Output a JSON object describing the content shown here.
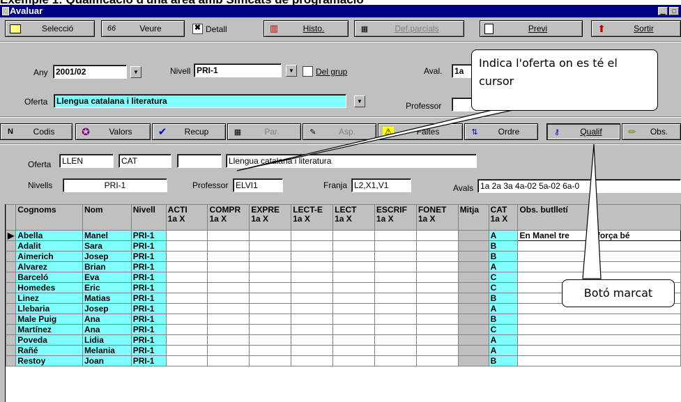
{
  "heading": "Exemple 1: Qualificació d'una àrea amb Simcats de programació",
  "window": {
    "title": "Avaluar",
    "min_glyph": "▁",
    "max_glyph": "□"
  },
  "toolbar1": [
    {
      "name": "seleccio-button",
      "icon": "folder-icon",
      "glyph": "🗀",
      "label": "Selecció",
      "disabled": false
    },
    {
      "name": "veure-button",
      "icon": "glasses-icon",
      "glyph": "66",
      "label": "Veure",
      "disabled": false
    },
    {
      "name": "histo-button",
      "icon": "chart-icon",
      "glyph": "▥",
      "label": "Histo.",
      "disabled": false
    },
    {
      "name": "def-parcials-button",
      "icon": "calendar-icon",
      "glyph": "▦",
      "label": "Def.parcials",
      "disabled": true
    },
    {
      "name": "previ-button",
      "icon": "preview-icon",
      "glyph": "🔍",
      "label": "Previ",
      "disabled": false
    },
    {
      "name": "sortir-button",
      "icon": "exit-icon",
      "glyph": "⬆",
      "label": "Sortir",
      "disabled": false
    }
  ],
  "detall": {
    "label": "Detall",
    "checked": "✖"
  },
  "form": {
    "any_label": "Any",
    "any_value": "2001/02",
    "nivell_label": "Nivell",
    "nivell_value": "PRI-1",
    "del_grup_label": "Del grup",
    "aval_label": "Aval.",
    "aval_value": "1a",
    "oferta_label": "Oferta",
    "oferta_value": "Llengua catalana i literatura",
    "professor_label": "Professor",
    "professor_value": ""
  },
  "toolbar2": [
    {
      "name": "codis-button",
      "icon": "codes-icon",
      "glyph": "N",
      "label": "Codis",
      "disabled": false,
      "pressed": false
    },
    {
      "name": "valors-button",
      "icon": "values-icon",
      "glyph": "✪",
      "label": "Valors",
      "disabled": false,
      "pressed": false
    },
    {
      "name": "recup-button",
      "icon": "check-icon",
      "glyph": "✔",
      "label": "Recup",
      "disabled": false,
      "pressed": false
    },
    {
      "name": "par-button",
      "icon": "calendar-icon",
      "glyph": "▦",
      "label": "Par.",
      "disabled": true,
      "pressed": false
    },
    {
      "name": "asp-button",
      "icon": "aspects-icon",
      "glyph": "✎",
      "label": "Asp.",
      "disabled": true,
      "pressed": false
    },
    {
      "name": "faltes-button",
      "icon": "warning-icon",
      "glyph": "⚠",
      "label": "Faltes",
      "disabled": false,
      "pressed": false
    },
    {
      "name": "ordre-button",
      "icon": "order-icon",
      "glyph": "⇅",
      "label": "Ordre",
      "disabled": false,
      "pressed": false
    },
    {
      "name": "qualif-button",
      "icon": "key-icon",
      "glyph": "⚷",
      "label": "Qualif",
      "disabled": false,
      "pressed": true
    },
    {
      "name": "obs-button",
      "icon": "pencil-icon",
      "glyph": "✏",
      "label": "Obs.",
      "disabled": false,
      "pressed": false
    }
  ],
  "info": {
    "oferta_label": "Oferta",
    "oferta_code1": "LLEN",
    "oferta_code2": "CAT",
    "oferta_code3": "",
    "oferta_desc": "Llengua catalana i literatura",
    "nivells_label": "Nivells",
    "nivells_value": "PRI-1",
    "professor_label": "Professor",
    "professor_value": "ELVI1",
    "franja_label": "Franja",
    "franja_value": "L2,X1,V1",
    "avals_label": "Avals",
    "avals_value": "1a 2a 3a 4a-02 5a-02 6a-0"
  },
  "table": {
    "headers": [
      {
        "l1": "Cognoms",
        "l2": ""
      },
      {
        "l1": "Nom",
        "l2": ""
      },
      {
        "l1": "Nivell",
        "l2": ""
      },
      {
        "l1": "ACTI",
        "l2": "1a X"
      },
      {
        "l1": "COMPR",
        "l2": "1a X"
      },
      {
        "l1": "EXPRE",
        "l2": "1a X"
      },
      {
        "l1": "LECT-E",
        "l2": "1a X"
      },
      {
        "l1": "LECT",
        "l2": "1a X"
      },
      {
        "l1": "ESCRIF",
        "l2": "1a X"
      },
      {
        "l1": "FONET",
        "l2": "1a X"
      },
      {
        "l1": "Mitja",
        "l2": ""
      },
      {
        "l1": "CAT",
        "l2": "1a X"
      },
      {
        "l1": "Obs. butlletí",
        "l2": ""
      }
    ],
    "rows": [
      {
        "cognoms": "Abella",
        "nom": "Manel",
        "nivell": "PRI-1",
        "cat": "A",
        "obs": "En Manel tre",
        "obs2": "força bé"
      },
      {
        "cognoms": "Adalit",
        "nom": "Sara",
        "nivell": "PRI-1",
        "cat": "B",
        "obs": "",
        "obs2": ""
      },
      {
        "cognoms": "Aimerich",
        "nom": "Josep",
        "nivell": "PRI-1",
        "cat": "B",
        "obs": "",
        "obs2": ""
      },
      {
        "cognoms": "Alvarez",
        "nom": "Brian",
        "nivell": "PRI-1",
        "cat": "A",
        "obs": "",
        "obs2": ""
      },
      {
        "cognoms": "Barceló",
        "nom": "Eva",
        "nivell": "PRI-1",
        "cat": "C",
        "obs": "",
        "obs2": ""
      },
      {
        "cognoms": "Homedes",
        "nom": "Eric",
        "nivell": "PRI-1",
        "cat": "C",
        "obs": "",
        "obs2": ""
      },
      {
        "cognoms": "Linez",
        "nom": "Matias",
        "nivell": "PRI-1",
        "cat": "B",
        "obs": "",
        "obs2": ""
      },
      {
        "cognoms": "Llebaria",
        "nom": "Josep",
        "nivell": "PRI-1",
        "cat": "A",
        "obs": "",
        "obs2": ""
      },
      {
        "cognoms": "Male Puig",
        "nom": "Ana",
        "nivell": "PRI-1",
        "cat": "B",
        "obs": "",
        "obs2": ""
      },
      {
        "cognoms": "Martínez",
        "nom": "Ana",
        "nivell": "PRI-1",
        "cat": "C",
        "obs": "",
        "obs2": ""
      },
      {
        "cognoms": "Poveda",
        "nom": "Lidia",
        "nivell": "PRI-1",
        "cat": "A",
        "obs": "",
        "obs2": ""
      },
      {
        "cognoms": "Rañé",
        "nom": "Melania",
        "nivell": "PRI-1",
        "cat": "A",
        "obs": "",
        "obs2": ""
      },
      {
        "cognoms": "Restoy",
        "nom": "Joan",
        "nivell": "PRI-1",
        "cat": "B",
        "obs": "",
        "obs2": ""
      }
    ]
  },
  "callouts": {
    "cursor": "Indica l'oferta on es té el cursor",
    "button": "Botó marcat"
  },
  "colors": {
    "title_bar": "#000080",
    "cyan": "#80ffff",
    "face": "#c0c0c0"
  }
}
